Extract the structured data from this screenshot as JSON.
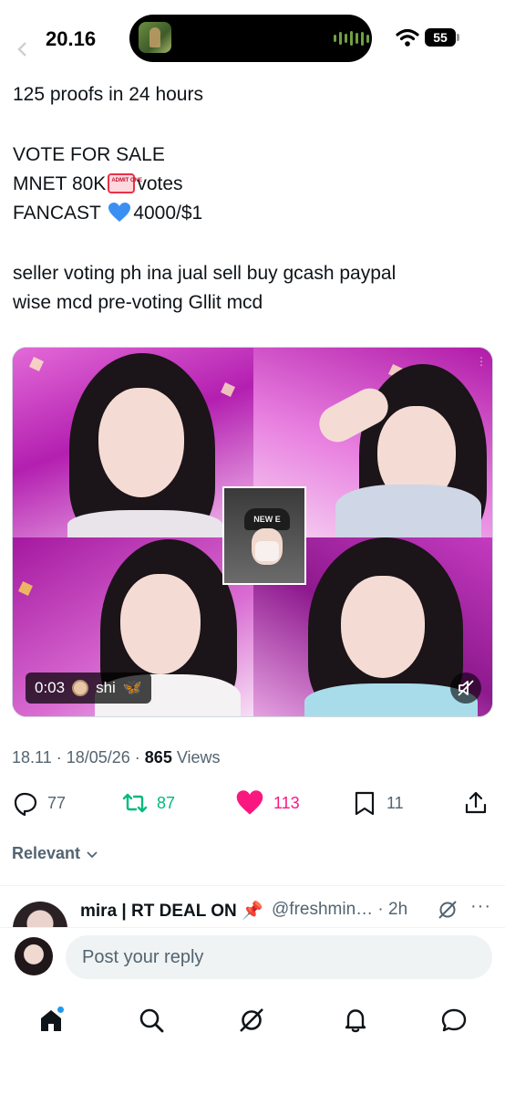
{
  "status_bar": {
    "time": "20.16",
    "battery": "55"
  },
  "tweet": {
    "lines": [
      "125 proofs in 24 hours",
      "VOTE FOR SALE",
      "MNET 80K",
      "votes",
      "FANCAST",
      "4000/$1",
      "seller voting ph ina jual sell buy gcash paypal",
      "wise mcd pre-voting Gllit mcd"
    ],
    "media": {
      "time": "0:03",
      "uploader": "shi",
      "inset_label": "NEW E",
      "mute_icon": "speaker-muted-icon"
    },
    "meta": {
      "time": "18.11",
      "date": "18/05/26",
      "views_count": "865",
      "views_label": "Views"
    },
    "actions": {
      "replies": "77",
      "reposts": "87",
      "likes": "113",
      "bookmarks": "11"
    }
  },
  "sort": {
    "label": "Relevant"
  },
  "reply_preview": {
    "name": "mira | RT DEAL ON",
    "handle": "@freshmin…",
    "age": "2h"
  },
  "composer": {
    "placeholder": "Post your reply"
  },
  "tabbar": {
    "items": [
      "home-icon",
      "search-icon",
      "grok-icon",
      "bell-icon",
      "messages-icon"
    ]
  },
  "colors": {
    "text": "#0f1419",
    "muted": "#536471",
    "repost": "#00ba7c",
    "like": "#f91880",
    "accent": "#1d9bf0"
  }
}
